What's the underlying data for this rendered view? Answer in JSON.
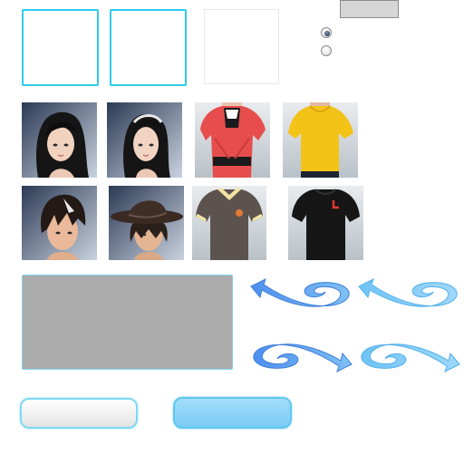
{
  "icons": {
    "female_hair_1": "female-long-black-hair-icon",
    "female_hair_2": "female-hair-with-headband-icon",
    "female_top_1": "red-layered-top-icon",
    "female_top_2": "yellow-blouse-icon",
    "male_hair_1": "male-spiky-hair-icon",
    "male_hair_2": "male-hat-icon",
    "male_shirt_1": "grey-polo-shirt-icon",
    "male_shirt_2": "black-tshirt-icon",
    "rotate_left_top": "rotate-left-spiral-arrow-icon",
    "rotate_right_top": "rotate-right-spiral-arrow-icon",
    "rotate_left_bottom": "rotate-left-spiral-arrow-icon",
    "rotate_right_bottom": "rotate-right-spiral-arrow-icon"
  },
  "radios": {
    "first_checked": true,
    "second_checked": false
  },
  "colors": {
    "accent": "#2ecbef",
    "preview_bg": "#ababab",
    "arrow_light": "#6fc3f5",
    "arrow_dark": "#4e8ff0",
    "button_blue": "#8ad3f7"
  }
}
